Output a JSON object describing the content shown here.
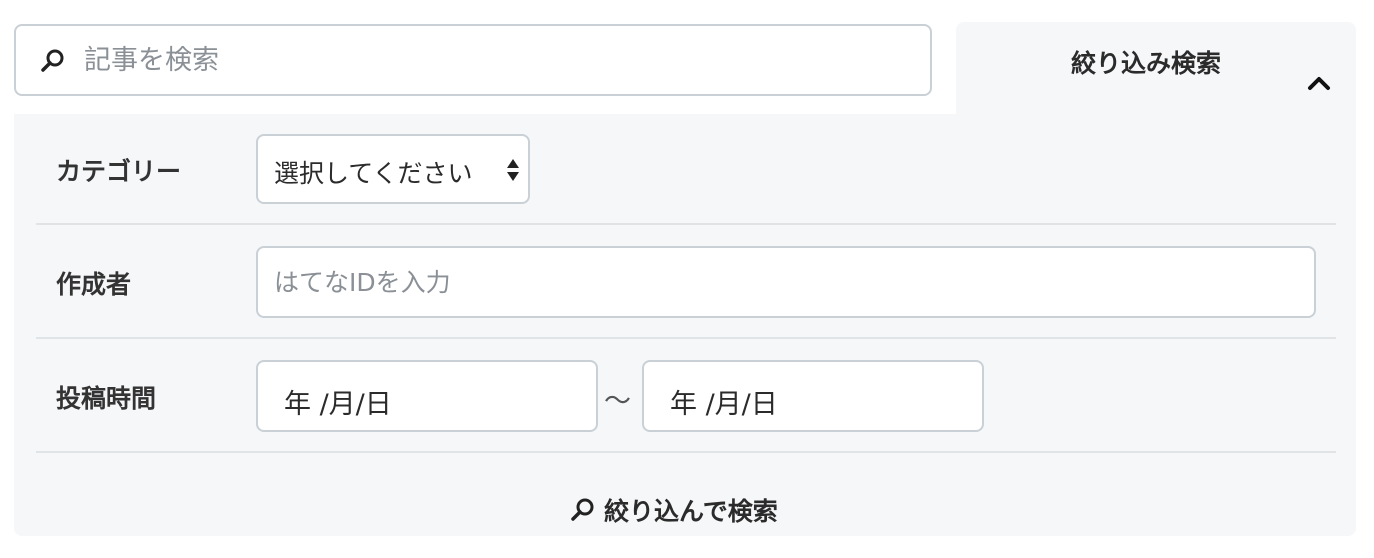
{
  "search": {
    "placeholder": "記事を検索",
    "icon": "search-icon"
  },
  "filter_toggle": {
    "label": "絞り込み検索",
    "icon": "chevron-up-icon"
  },
  "filters": {
    "category": {
      "label": "カテゴリー",
      "selected": "選択してください"
    },
    "author": {
      "label": "作成者",
      "placeholder": "はてなIDを入力"
    },
    "post_time": {
      "label": "投稿時間",
      "from_placeholder": "年 /月/日",
      "separator": "〜",
      "to_placeholder": "年 /月/日"
    }
  },
  "submit": {
    "label": "絞り込んで検索",
    "icon": "search-icon"
  },
  "colors": {
    "panel_bg": "#f6f7f9",
    "border": "#c9d0d6",
    "divider": "#e1e4e7",
    "text": "#2b2b2b",
    "placeholder": "#8a9096"
  }
}
